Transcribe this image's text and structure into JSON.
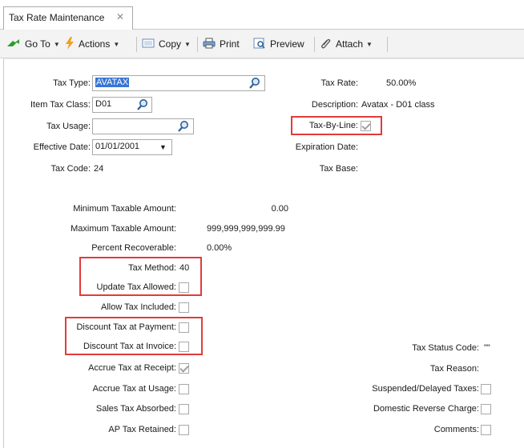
{
  "tab": {
    "title": "Tax Rate Maintenance",
    "close": "✕"
  },
  "toolbar": {
    "goto_label": "Go To",
    "actions_label": "Actions",
    "copy_label": "Copy",
    "print_label": "Print",
    "preview_label": "Preview",
    "attach_label": "Attach"
  },
  "form": {
    "tax_type_label": "Tax Type:",
    "tax_type_value": "AVATAX",
    "item_tax_class_label": "Item Tax Class:",
    "item_tax_class_value": "D01",
    "tax_usage_label": "Tax Usage:",
    "tax_usage_value": "",
    "effective_date_label": "Effective Date:",
    "effective_date_value": "01/01/2001",
    "tax_code_label": "Tax Code:",
    "tax_code_value": "24",
    "tax_rate_label": "Tax Rate:",
    "tax_rate_value": "50.00%",
    "description_label": "Description:",
    "description_value": "Avatax - D01 class",
    "tax_by_line_label": "Tax-By-Line:",
    "expiration_date_label": "Expiration Date:",
    "tax_base_label": "Tax Base:",
    "min_taxable_label": "Minimum Taxable Amount:",
    "min_taxable_value": "0.00",
    "max_taxable_label": "Maximum Taxable Amount:",
    "max_taxable_value": "999,999,999,999.99",
    "percent_recoverable_label": "Percent Recoverable:",
    "percent_recoverable_value": "0.00%",
    "tax_method_label": "Tax Method:",
    "tax_method_value": "40",
    "update_tax_allowed_label": "Update Tax Allowed:",
    "allow_tax_included_label": "Allow Tax Included:",
    "discount_payment_label": "Discount Tax at Payment:",
    "discount_invoice_label": "Discount Tax at Invoice:",
    "accrue_receipt_label": "Accrue Tax at Receipt:",
    "accrue_usage_label": "Accrue Tax at Usage:",
    "sales_tax_absorbed_label": "Sales Tax Absorbed:",
    "ap_tax_retained_label": "AP Tax Retained:",
    "tax_status_code_label": "Tax Status Code:",
    "tax_status_code_value": "\"\"",
    "tax_reason_label": "Tax Reason:",
    "suspended_label": "Suspended/Delayed Taxes:",
    "domestic_reverse_label": "Domestic Reverse Charge:",
    "comments_label": "Comments:"
  },
  "colors": {
    "highlight": "#e23b3b",
    "selection": "#3875d7"
  }
}
